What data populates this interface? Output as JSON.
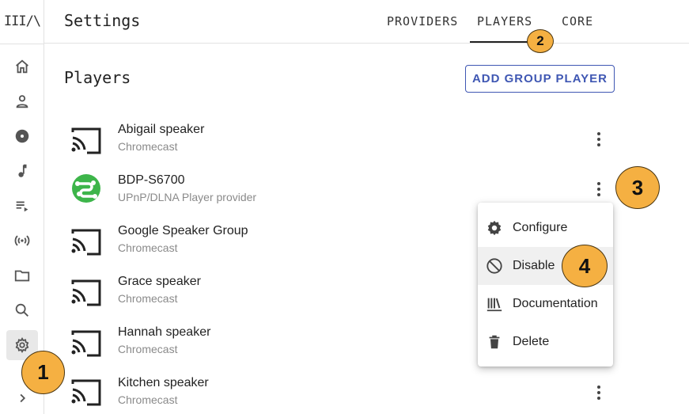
{
  "app": {
    "logo_text": "III/\\"
  },
  "header": {
    "title": "Settings",
    "tabs": [
      {
        "label": "PROVIDERS"
      },
      {
        "label": "PLAYERS"
      },
      {
        "label": "CORE"
      }
    ]
  },
  "sidebar": {
    "items": [
      {
        "icon": "home-icon"
      },
      {
        "icon": "person-icon"
      },
      {
        "icon": "album-icon"
      },
      {
        "icon": "music-note-icon"
      },
      {
        "icon": "playlist-icon"
      },
      {
        "icon": "radio-icon"
      },
      {
        "icon": "folder-icon"
      },
      {
        "icon": "search-icon"
      },
      {
        "icon": "gear-icon",
        "active": true
      },
      {
        "icon": "chevron-right-icon"
      }
    ]
  },
  "main": {
    "section_title": "Players",
    "add_button_label": "ADD GROUP PLAYER",
    "players": [
      {
        "name": "Abigail speaker",
        "provider": "Chromecast",
        "icon": "cast-icon"
      },
      {
        "name": "BDP-S6700",
        "provider": "UPnP/DLNA Player provider",
        "icon": "dlna-icon"
      },
      {
        "name": "Google Speaker Group",
        "provider": "Chromecast",
        "icon": "cast-icon"
      },
      {
        "name": "Grace speaker",
        "provider": "Chromecast",
        "icon": "cast-icon"
      },
      {
        "name": "Hannah speaker",
        "provider": "Chromecast",
        "icon": "cast-icon"
      },
      {
        "name": "Kitchen speaker",
        "provider": "Chromecast",
        "icon": "cast-icon"
      }
    ]
  },
  "context_menu": {
    "items": [
      {
        "label": "Configure",
        "icon": "gear-icon"
      },
      {
        "label": "Disable",
        "icon": "block-icon"
      },
      {
        "label": "Documentation",
        "icon": "library-icon"
      },
      {
        "label": "Delete",
        "icon": "trash-icon"
      }
    ]
  },
  "badges": [
    "1",
    "2",
    "3",
    "4"
  ],
  "colors": {
    "accent": "#3f57b3",
    "badge": "#f5b042",
    "dlna_green": "#3db54a"
  }
}
